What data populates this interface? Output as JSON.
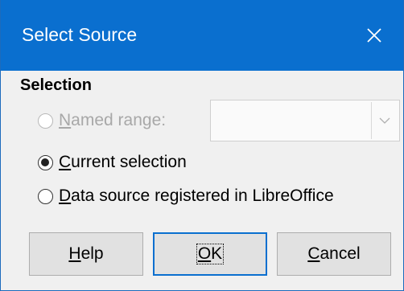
{
  "dialog": {
    "title": "Select Source",
    "close_icon": "close-icon"
  },
  "selection": {
    "heading": "Selection",
    "options": [
      {
        "mnemonic": "N",
        "rest": "amed range:",
        "checked": false,
        "enabled": false
      },
      {
        "mnemonic": "C",
        "rest": "urrent selection",
        "checked": true,
        "enabled": true
      },
      {
        "mnemonic": "D",
        "rest": "ata source registered in LibreOffice",
        "checked": false,
        "enabled": true
      }
    ],
    "named_range_value": ""
  },
  "buttons": {
    "help": {
      "mnemonic": "H",
      "rest": "elp"
    },
    "ok": {
      "mnemonic": "O",
      "rest": "K"
    },
    "cancel": {
      "mnemonic": "C",
      "rest": "ancel"
    }
  },
  "colors": {
    "titlebar": "#0a6fcf",
    "dialog_bg": "#f0f0f0",
    "button_bg": "#e1e1e1"
  }
}
